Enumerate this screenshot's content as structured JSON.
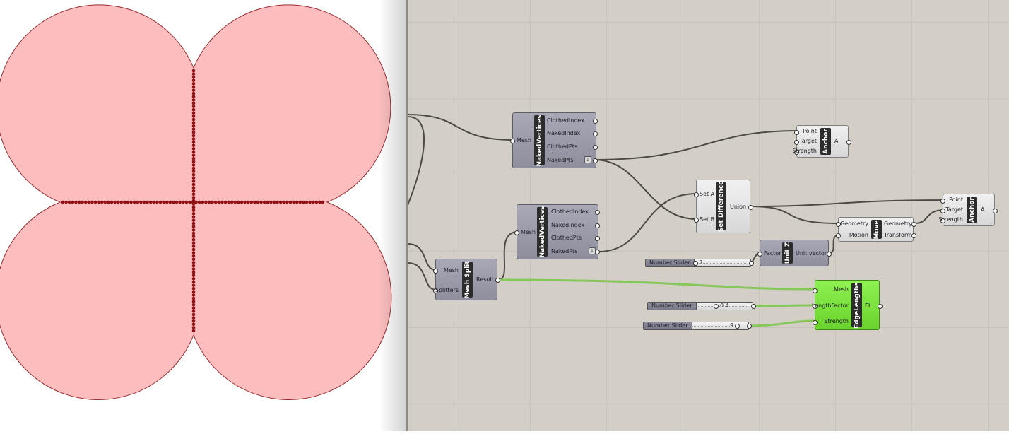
{
  "components": {
    "naked_vertices_1": {
      "title": "NakedVertices",
      "input": "Mesh",
      "outputs": [
        "ClothedIndex",
        "NakedIndex",
        "ClothedPts",
        "NakedPts"
      ]
    },
    "naked_vertices_2": {
      "title": "NakedVertices",
      "input": "Mesh",
      "outputs": [
        "ClothedIndex",
        "NakedIndex",
        "ClothedPts",
        "NakedPts"
      ]
    },
    "mesh_split": {
      "title": "Mesh Split",
      "inputs": [
        "Mesh",
        "Splitters"
      ],
      "output": "Result"
    },
    "anchor_1": {
      "title": "Anchor",
      "inputs": [
        "Point",
        "Target",
        "Strength"
      ],
      "output": "A"
    },
    "set_difference": {
      "title": "Set Difference",
      "inputs": [
        "Set A",
        "Set B"
      ],
      "output": "Union"
    },
    "move": {
      "title": "Move",
      "inputs": [
        "Geometry",
        "Motion"
      ],
      "outputs": [
        "Geometry",
        "Transform"
      ]
    },
    "anchor_2": {
      "title": "Anchor",
      "inputs": [
        "Point",
        "Target",
        "Strength"
      ],
      "output": "A"
    },
    "unit_z": {
      "title": "Unit Z",
      "input": "Factor",
      "output": "Unit vector"
    },
    "edge_lengths": {
      "title": "EdgeLengths",
      "inputs": [
        "Mesh",
        "LengthFactor",
        "Strength"
      ],
      "output": "EL"
    }
  },
  "sliders": [
    {
      "label": "Number Slider",
      "value": "3",
      "fraction": 0.0
    },
    {
      "label": "Number Slider",
      "value": "0.4",
      "fraction": 0.4
    },
    {
      "label": "Number Slider",
      "value": "9",
      "fraction": 1.0
    }
  ],
  "colors": {
    "canvas": "#d3cfc6",
    "mesh_fill": "#fbbdbe",
    "mesh_edge": "#9b2a2e",
    "points": "#8e0f14",
    "component": "#9a99a8",
    "enabled_component": "#7ee043",
    "wire": "#4d4a44",
    "selected_wire": "#86c75a"
  }
}
